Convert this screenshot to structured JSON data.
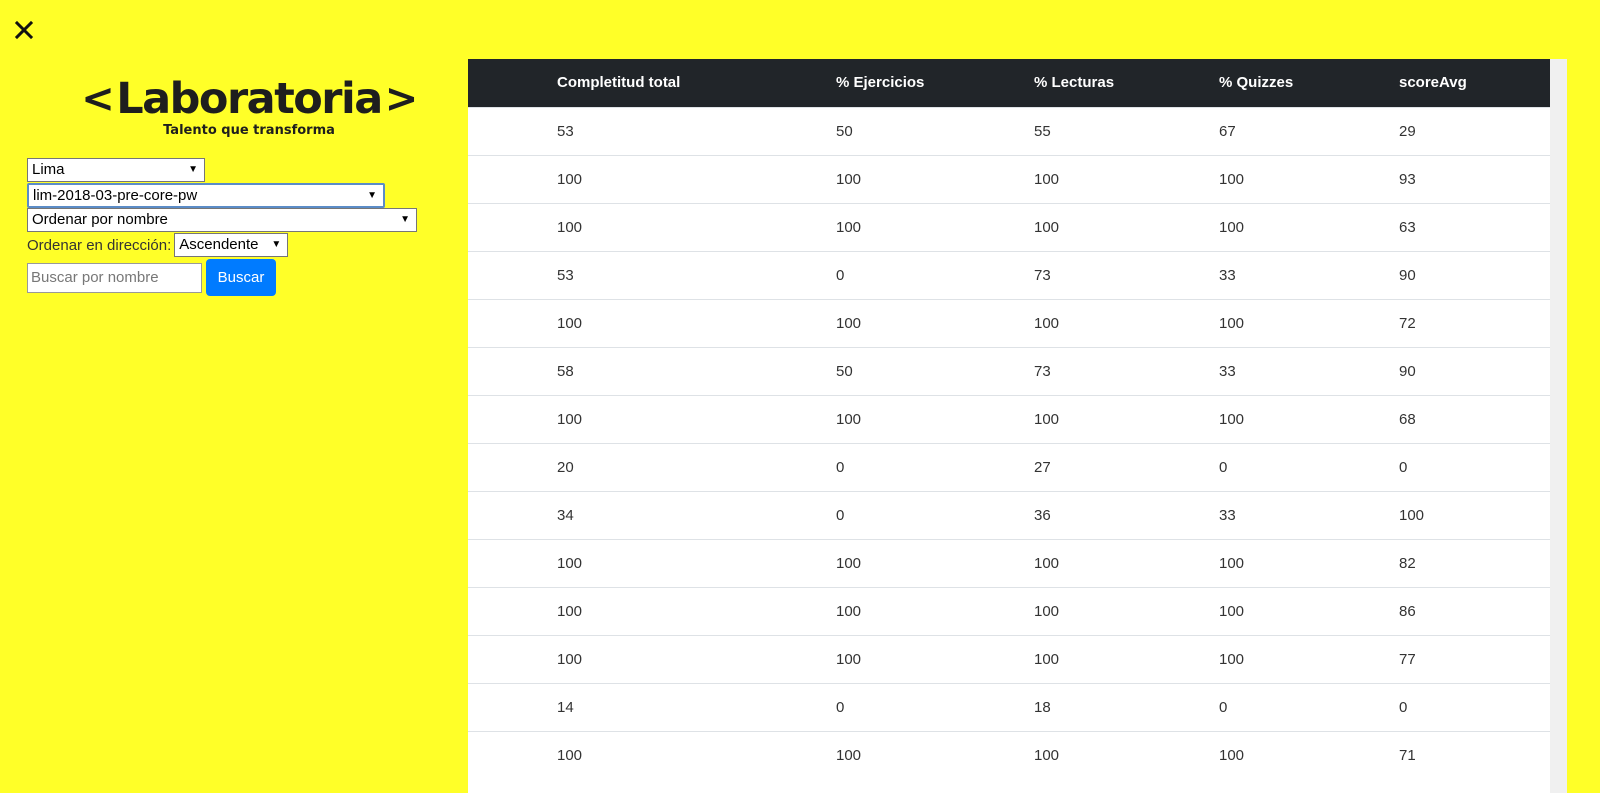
{
  "logo": {
    "name": "Laboratoria",
    "tagline": "Talento que transforma",
    "chevron_left": "<",
    "chevron_right": ">"
  },
  "filters": {
    "region": "Lima",
    "cohort": "lim-2018-03-pre-core-pw",
    "order_by": "Ordenar por nombre",
    "direction_label": "Ordenar en dirección:",
    "direction": "Ascendente",
    "search_placeholder": "Buscar por nombre",
    "search_button": "Buscar"
  },
  "table": {
    "headers": [
      "Completitud total",
      "% Ejercicios",
      "% Lecturas",
      "% Quizzes",
      "scoreAvg"
    ],
    "rows": [
      [
        "53",
        "50",
        "55",
        "67",
        "29"
      ],
      [
        "100",
        "100",
        "100",
        "100",
        "93"
      ],
      [
        "100",
        "100",
        "100",
        "100",
        "63"
      ],
      [
        "53",
        "0",
        "73",
        "33",
        "90"
      ],
      [
        "100",
        "100",
        "100",
        "100",
        "72"
      ],
      [
        "58",
        "50",
        "73",
        "33",
        "90"
      ],
      [
        "100",
        "100",
        "100",
        "100",
        "68"
      ],
      [
        "20",
        "0",
        "27",
        "0",
        "0"
      ],
      [
        "34",
        "0",
        "36",
        "33",
        "100"
      ],
      [
        "100",
        "100",
        "100",
        "100",
        "82"
      ],
      [
        "100",
        "100",
        "100",
        "100",
        "86"
      ],
      [
        "100",
        "100",
        "100",
        "100",
        "77"
      ],
      [
        "14",
        "0",
        "18",
        "0",
        "0"
      ],
      [
        "100",
        "100",
        "100",
        "100",
        "71"
      ]
    ]
  },
  "colors": {
    "background": "#ffff28",
    "header": "#212529",
    "button": "#007bff"
  }
}
